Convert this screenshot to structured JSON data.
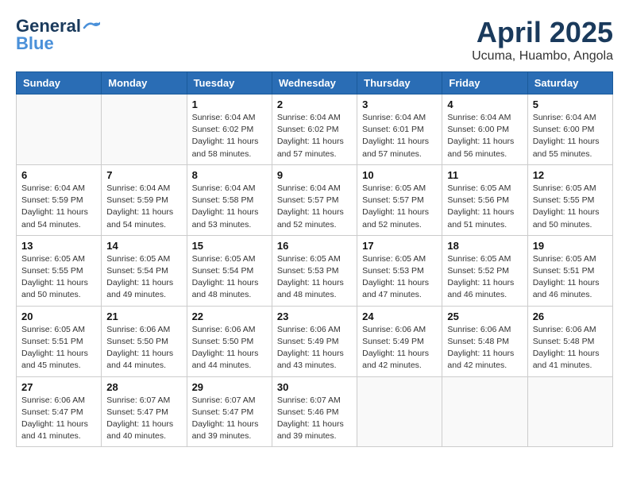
{
  "header": {
    "logo_line1": "General",
    "logo_line2": "Blue",
    "month": "April 2025",
    "location": "Ucuma, Huambo, Angola"
  },
  "weekdays": [
    "Sunday",
    "Monday",
    "Tuesday",
    "Wednesday",
    "Thursday",
    "Friday",
    "Saturday"
  ],
  "weeks": [
    [
      {
        "day": "",
        "info": ""
      },
      {
        "day": "",
        "info": ""
      },
      {
        "day": "1",
        "info": "Sunrise: 6:04 AM\nSunset: 6:02 PM\nDaylight: 11 hours and 58 minutes."
      },
      {
        "day": "2",
        "info": "Sunrise: 6:04 AM\nSunset: 6:02 PM\nDaylight: 11 hours and 57 minutes."
      },
      {
        "day": "3",
        "info": "Sunrise: 6:04 AM\nSunset: 6:01 PM\nDaylight: 11 hours and 57 minutes."
      },
      {
        "day": "4",
        "info": "Sunrise: 6:04 AM\nSunset: 6:00 PM\nDaylight: 11 hours and 56 minutes."
      },
      {
        "day": "5",
        "info": "Sunrise: 6:04 AM\nSunset: 6:00 PM\nDaylight: 11 hours and 55 minutes."
      }
    ],
    [
      {
        "day": "6",
        "info": "Sunrise: 6:04 AM\nSunset: 5:59 PM\nDaylight: 11 hours and 54 minutes."
      },
      {
        "day": "7",
        "info": "Sunrise: 6:04 AM\nSunset: 5:59 PM\nDaylight: 11 hours and 54 minutes."
      },
      {
        "day": "8",
        "info": "Sunrise: 6:04 AM\nSunset: 5:58 PM\nDaylight: 11 hours and 53 minutes."
      },
      {
        "day": "9",
        "info": "Sunrise: 6:04 AM\nSunset: 5:57 PM\nDaylight: 11 hours and 52 minutes."
      },
      {
        "day": "10",
        "info": "Sunrise: 6:05 AM\nSunset: 5:57 PM\nDaylight: 11 hours and 52 minutes."
      },
      {
        "day": "11",
        "info": "Sunrise: 6:05 AM\nSunset: 5:56 PM\nDaylight: 11 hours and 51 minutes."
      },
      {
        "day": "12",
        "info": "Sunrise: 6:05 AM\nSunset: 5:55 PM\nDaylight: 11 hours and 50 minutes."
      }
    ],
    [
      {
        "day": "13",
        "info": "Sunrise: 6:05 AM\nSunset: 5:55 PM\nDaylight: 11 hours and 50 minutes."
      },
      {
        "day": "14",
        "info": "Sunrise: 6:05 AM\nSunset: 5:54 PM\nDaylight: 11 hours and 49 minutes."
      },
      {
        "day": "15",
        "info": "Sunrise: 6:05 AM\nSunset: 5:54 PM\nDaylight: 11 hours and 48 minutes."
      },
      {
        "day": "16",
        "info": "Sunrise: 6:05 AM\nSunset: 5:53 PM\nDaylight: 11 hours and 48 minutes."
      },
      {
        "day": "17",
        "info": "Sunrise: 6:05 AM\nSunset: 5:53 PM\nDaylight: 11 hours and 47 minutes."
      },
      {
        "day": "18",
        "info": "Sunrise: 6:05 AM\nSunset: 5:52 PM\nDaylight: 11 hours and 46 minutes."
      },
      {
        "day": "19",
        "info": "Sunrise: 6:05 AM\nSunset: 5:51 PM\nDaylight: 11 hours and 46 minutes."
      }
    ],
    [
      {
        "day": "20",
        "info": "Sunrise: 6:05 AM\nSunset: 5:51 PM\nDaylight: 11 hours and 45 minutes."
      },
      {
        "day": "21",
        "info": "Sunrise: 6:06 AM\nSunset: 5:50 PM\nDaylight: 11 hours and 44 minutes."
      },
      {
        "day": "22",
        "info": "Sunrise: 6:06 AM\nSunset: 5:50 PM\nDaylight: 11 hours and 44 minutes."
      },
      {
        "day": "23",
        "info": "Sunrise: 6:06 AM\nSunset: 5:49 PM\nDaylight: 11 hours and 43 minutes."
      },
      {
        "day": "24",
        "info": "Sunrise: 6:06 AM\nSunset: 5:49 PM\nDaylight: 11 hours and 42 minutes."
      },
      {
        "day": "25",
        "info": "Sunrise: 6:06 AM\nSunset: 5:48 PM\nDaylight: 11 hours and 42 minutes."
      },
      {
        "day": "26",
        "info": "Sunrise: 6:06 AM\nSunset: 5:48 PM\nDaylight: 11 hours and 41 minutes."
      }
    ],
    [
      {
        "day": "27",
        "info": "Sunrise: 6:06 AM\nSunset: 5:47 PM\nDaylight: 11 hours and 41 minutes."
      },
      {
        "day": "28",
        "info": "Sunrise: 6:07 AM\nSunset: 5:47 PM\nDaylight: 11 hours and 40 minutes."
      },
      {
        "day": "29",
        "info": "Sunrise: 6:07 AM\nSunset: 5:47 PM\nDaylight: 11 hours and 39 minutes."
      },
      {
        "day": "30",
        "info": "Sunrise: 6:07 AM\nSunset: 5:46 PM\nDaylight: 11 hours and 39 minutes."
      },
      {
        "day": "",
        "info": ""
      },
      {
        "day": "",
        "info": ""
      },
      {
        "day": "",
        "info": ""
      }
    ]
  ]
}
